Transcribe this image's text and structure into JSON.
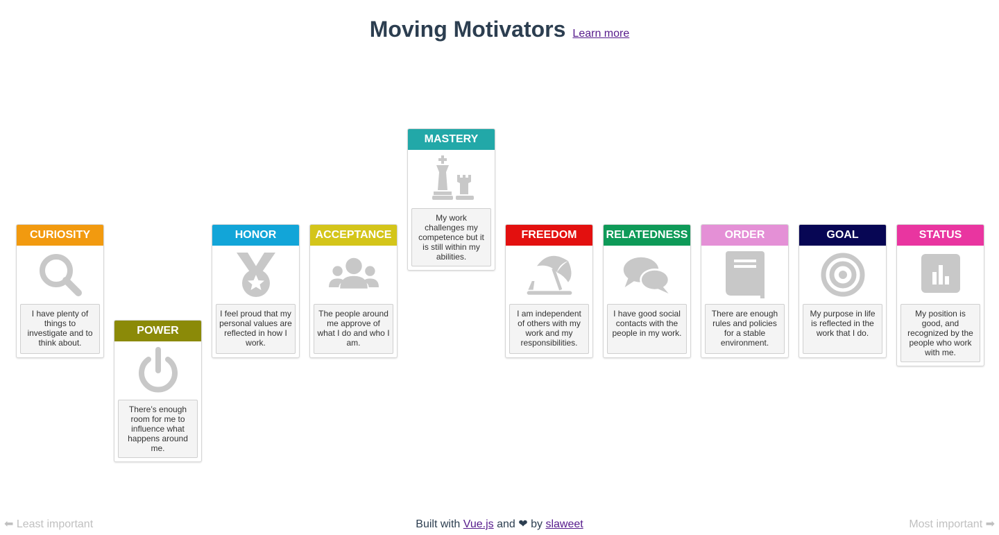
{
  "header": {
    "title": "Moving Motivators",
    "learn_more": "Learn more"
  },
  "cards": [
    {
      "key": "curiosity",
      "title": "CURIOSITY",
      "color": "#f29a0f",
      "icon": "magnifier-icon",
      "text": "I have plenty of things to investigate and to think about."
    },
    {
      "key": "power",
      "title": "POWER",
      "color": "#8b8a08",
      "icon": "power-icon",
      "text": "There’s enough room for me to influence what happens around me."
    },
    {
      "key": "honor",
      "title": "HONOR",
      "color": "#12a5d8",
      "icon": "medal-icon",
      "text": "I feel proud that my personal values are reflected in how I work."
    },
    {
      "key": "acceptance",
      "title": "ACCEPTANCE",
      "color": "#d4c51a",
      "icon": "people-icon",
      "text": "The people around me approve of what I do and who I am."
    },
    {
      "key": "mastery",
      "title": "MASTERY",
      "color": "#22a8a8",
      "icon": "chess-icon",
      "text": "My work challenges my competence but it is still within my abilities."
    },
    {
      "key": "freedom",
      "title": "FREEDOM",
      "color": "#e3100f",
      "icon": "beach-umbrella-icon",
      "text": "I am independent of others with my work and my responsibilities."
    },
    {
      "key": "relatedness",
      "title": "RELATEDNESS",
      "color": "#0e9a58",
      "icon": "chat-bubbles-icon",
      "text": "I have good social contacts with the people in my work."
    },
    {
      "key": "order",
      "title": "ORDER",
      "color": "#e490d6",
      "icon": "book-icon",
      "text": "There are enough rules and policies for a stable environment."
    },
    {
      "key": "goal",
      "title": "GOAL",
      "color": "#070654",
      "icon": "target-icon",
      "text": "My purpose in life is reflected in the work that I do."
    },
    {
      "key": "status",
      "title": "STATUS",
      "color": "#e935a0",
      "icon": "bar-chart-icon",
      "text": "My position is good, and recognized by the people who work with me."
    }
  ],
  "footer": {
    "least": "⬅ Least important",
    "most": "Most important ➡",
    "built_prefix": "Built with",
    "vue_link": "Vue.js",
    "and_love": "and ❤ by",
    "author_link": "slaweet"
  }
}
